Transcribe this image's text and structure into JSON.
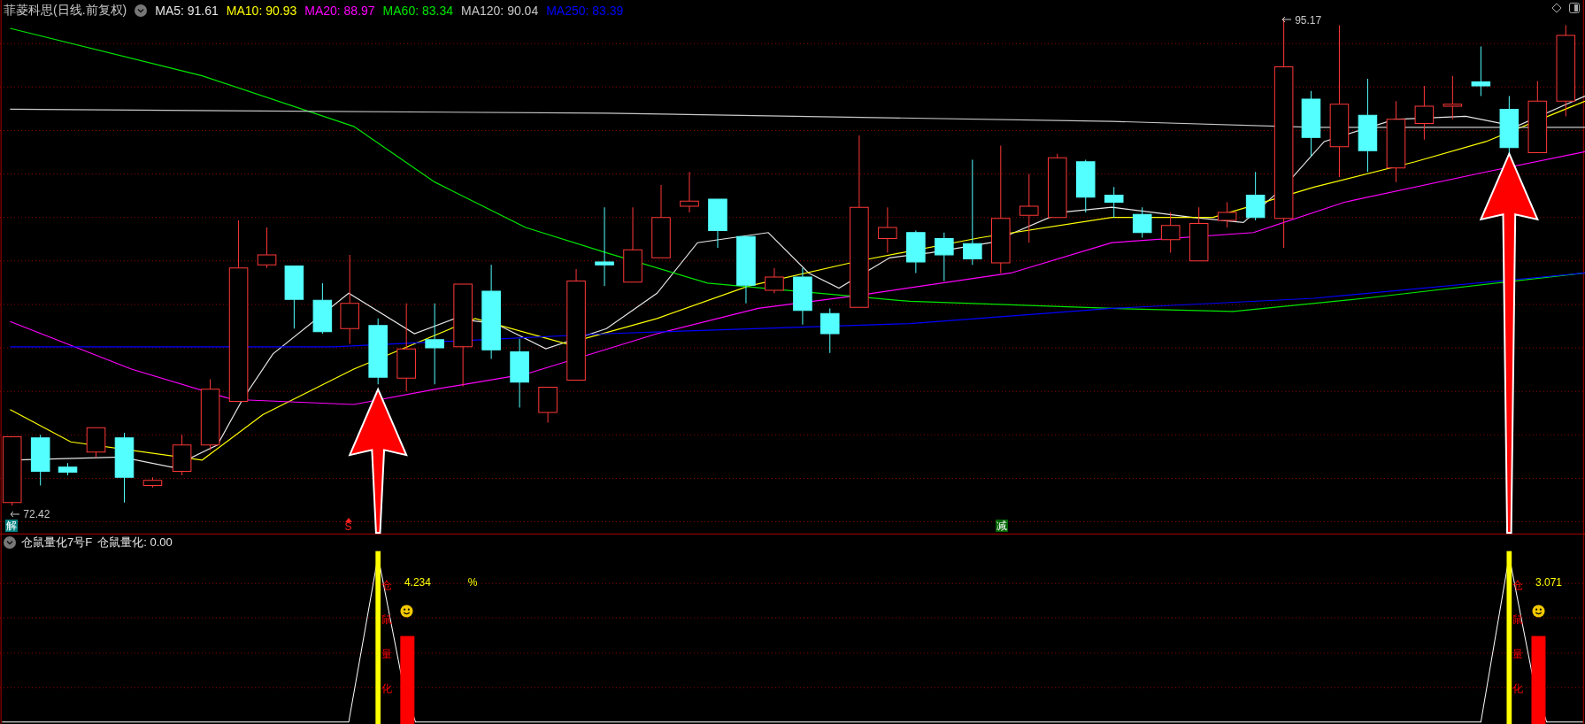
{
  "title": "菲菱科思(日线.前复权)",
  "ma_legend": [
    {
      "label": "MA5: 91.61",
      "color": "#e6e6e6"
    },
    {
      "label": "MA10: 90.93",
      "color": "#ffff00"
    },
    {
      "label": "MA20: 88.97",
      "color": "#ff00ff"
    },
    {
      "label": "MA60: 83.34",
      "color": "#00e600"
    },
    {
      "label": "MA120: 90.04",
      "color": "#c8c8c8"
    },
    {
      "label": "MA250: 83.39",
      "color": "#0000ff"
    }
  ],
  "price_labels": {
    "high": "95.17",
    "low": "72.42"
  },
  "markers": [
    {
      "kind": "badge",
      "text": "解",
      "color": "#008080"
    },
    {
      "kind": "signal",
      "text": "S",
      "color": "#ff2020"
    },
    {
      "kind": "badge",
      "text": "减",
      "color": "#006400"
    }
  ],
  "indicator": {
    "name": "仓鼠量化7号F",
    "value_label": "仓鼠量化: 0.00"
  },
  "signals": [
    {
      "value": "4.234",
      "unit": "%",
      "vertical_text": "仓鼠量化"
    },
    {
      "value": "3.071",
      "vertical_text": "仓鼠量化"
    }
  ]
}
